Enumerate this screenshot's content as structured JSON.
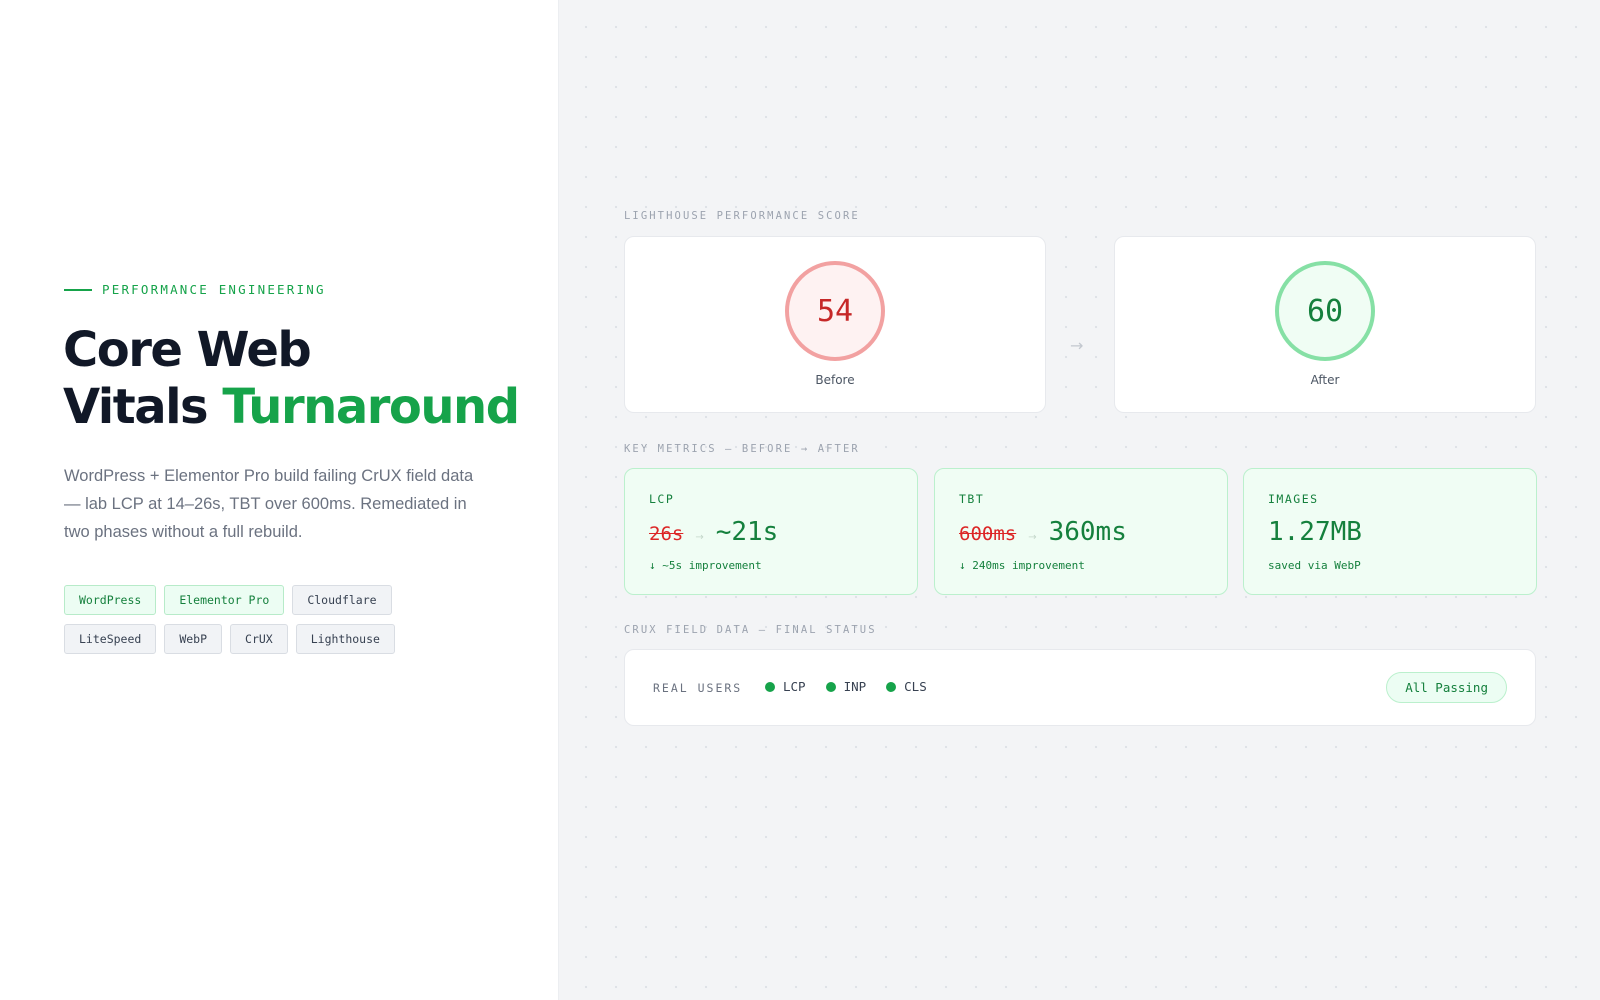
{
  "hero": {
    "eyebrow": "PERFORMANCE ENGINEERING",
    "title_line1": "Core Web",
    "title_line2_plain": "Vitals ",
    "title_line2_accent": "Turnaround",
    "description": "WordPress + Elementor Pro build failing CrUX field data — lab LCP at 14–26s, TBT over 600ms. Remediated in two phases without a full rebuild.",
    "tags": [
      {
        "label": "WordPress",
        "highlight": true
      },
      {
        "label": "Elementor Pro",
        "highlight": true
      },
      {
        "label": "Cloudflare",
        "highlight": false
      },
      {
        "label": "LiteSpeed",
        "highlight": false
      },
      {
        "label": "WebP",
        "highlight": false
      },
      {
        "label": "CrUX",
        "highlight": false
      },
      {
        "label": "Lighthouse",
        "highlight": false
      }
    ]
  },
  "scores": {
    "section_label": "LIGHTHOUSE PERFORMANCE SCORE",
    "before": {
      "value": "54",
      "caption": "Before"
    },
    "arrow": "→",
    "after": {
      "value": "60",
      "caption": "After"
    }
  },
  "metrics": {
    "section_label": "KEY METRICS — BEFORE → AFTER",
    "arrow": "→",
    "items": [
      {
        "name": "LCP",
        "before": "26s",
        "after": "~21s",
        "note": "↓ ~5s improvement"
      },
      {
        "name": "TBT",
        "before": "600ms",
        "after": "360ms",
        "note": "↓ 240ms improvement"
      },
      {
        "name": "IMAGES",
        "before": "",
        "after": "1.27MB",
        "note": "saved via WebP"
      }
    ]
  },
  "crux": {
    "section_label": "CRUX FIELD DATA — FINAL STATUS",
    "row_label": "REAL USERS",
    "vitals": [
      "LCP",
      "INP",
      "CLS"
    ],
    "status": "All Passing"
  },
  "colors": {
    "accent": "#16a34a",
    "bad": "#dc2626",
    "good_bg": "#f0fdf4"
  }
}
